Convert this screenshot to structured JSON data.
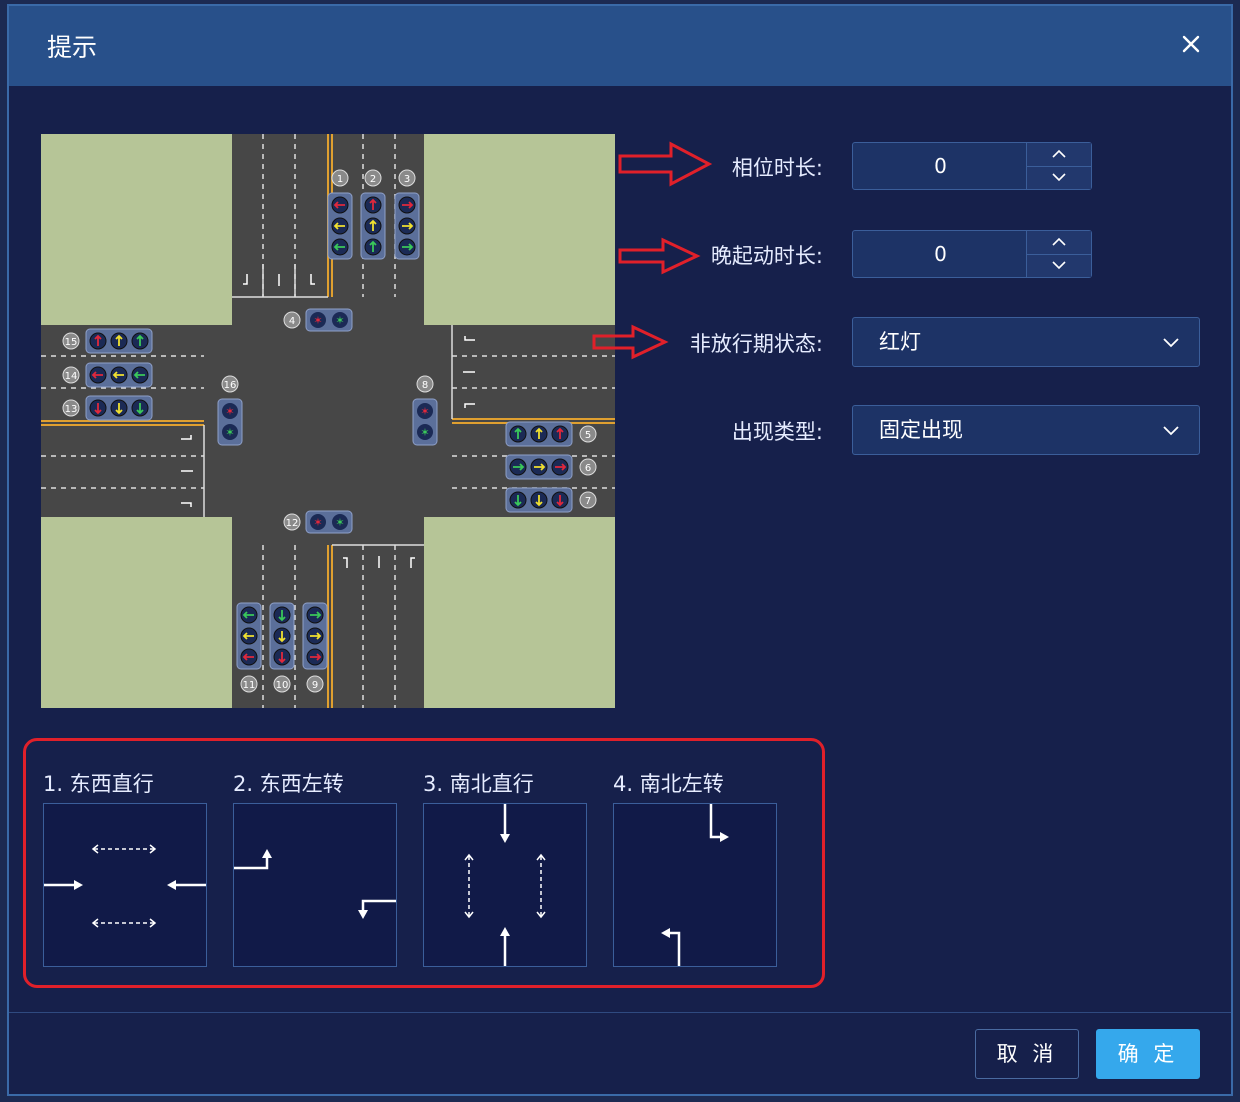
{
  "dialog": {
    "title": "提示"
  },
  "form": {
    "phase_duration": {
      "label": "相位时长:",
      "value": "0"
    },
    "late_start": {
      "label": "晚起动时长:",
      "value": "0"
    },
    "non_pass_state": {
      "label": "非放行期状态:",
      "value": "红灯"
    },
    "appear_type": {
      "label": "出现类型:",
      "value": "固定出现"
    }
  },
  "intersection": {
    "signal_numbers": [
      "1",
      "2",
      "3",
      "4",
      "5",
      "6",
      "7",
      "8",
      "9",
      "10",
      "11",
      "12",
      "13",
      "14",
      "15",
      "16"
    ]
  },
  "legend": {
    "items": [
      {
        "label": "1. 东西直行"
      },
      {
        "label": "2. 东西左转"
      },
      {
        "label": "3. 南北直行"
      },
      {
        "label": "4. 南北左转"
      }
    ]
  },
  "buttons": {
    "cancel": "取 消",
    "ok": "确 定"
  },
  "colors": {
    "accent": "#35a8ec",
    "annotation_red": "#e0202a",
    "signal_red": "#e0283c",
    "signal_yellow": "#f0e030",
    "signal_green": "#3ac85a"
  }
}
